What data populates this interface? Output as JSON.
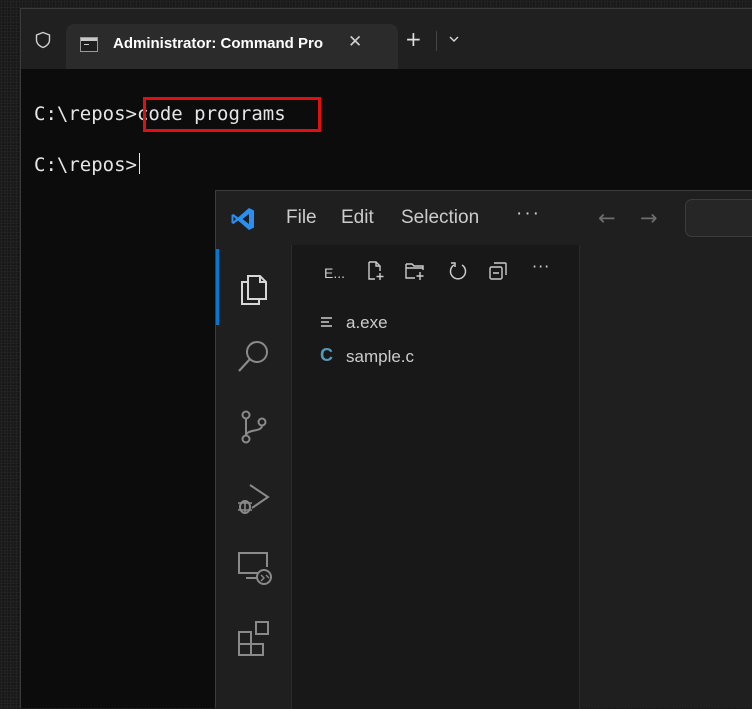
{
  "terminal": {
    "tab_title": "Administrator: Command Pro",
    "tab_close": "✕",
    "new_tab": "+",
    "lines": [
      {
        "prompt": "C:\\repos>",
        "command": "code programs"
      },
      {
        "prompt": "C:\\repos>",
        "command": ""
      }
    ],
    "highlight_color": "#e01010"
  },
  "vscode": {
    "menu": {
      "file": "File",
      "edit": "Edit",
      "selection": "Selection",
      "more": "···"
    },
    "nav": {
      "back": "←",
      "forward": "→"
    },
    "activity_bar": [
      "files-icon",
      "search-icon",
      "source-control-icon",
      "run-debug-icon",
      "remote-explorer-icon",
      "extensions-icon"
    ],
    "explorer": {
      "title": "E...",
      "more": "···",
      "files": [
        {
          "name": "a.exe",
          "icon": "text-file-icon"
        },
        {
          "name": "sample.c",
          "icon_label": "C",
          "icon": "c-file-icon"
        }
      ]
    },
    "accent": "#0078d4"
  }
}
